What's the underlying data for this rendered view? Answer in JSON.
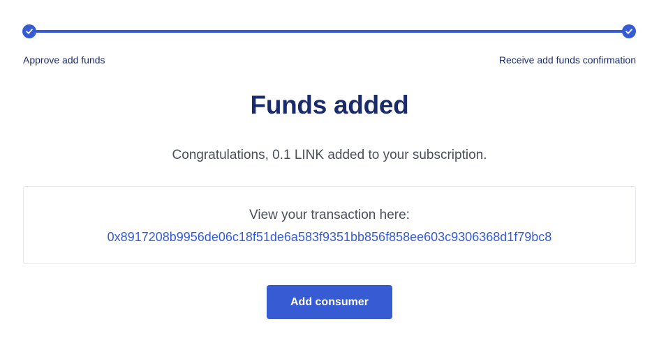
{
  "stepper": {
    "steps": [
      {
        "label": "Approve add funds",
        "status": "complete"
      },
      {
        "label": "Receive add funds confirmation",
        "status": "complete"
      }
    ],
    "progress": 1.0,
    "accent_color": "#375bd2"
  },
  "main": {
    "title": "Funds added",
    "message": "Congratulations, 0.1 LINK added to your subscription."
  },
  "transaction": {
    "label": "View your transaction here:",
    "hash": "0x8917208b9956de06c18f51de6a583f9351bb856f858ee603c9306368d1f79bc8"
  },
  "actions": {
    "add_consumer_label": "Add consumer"
  }
}
